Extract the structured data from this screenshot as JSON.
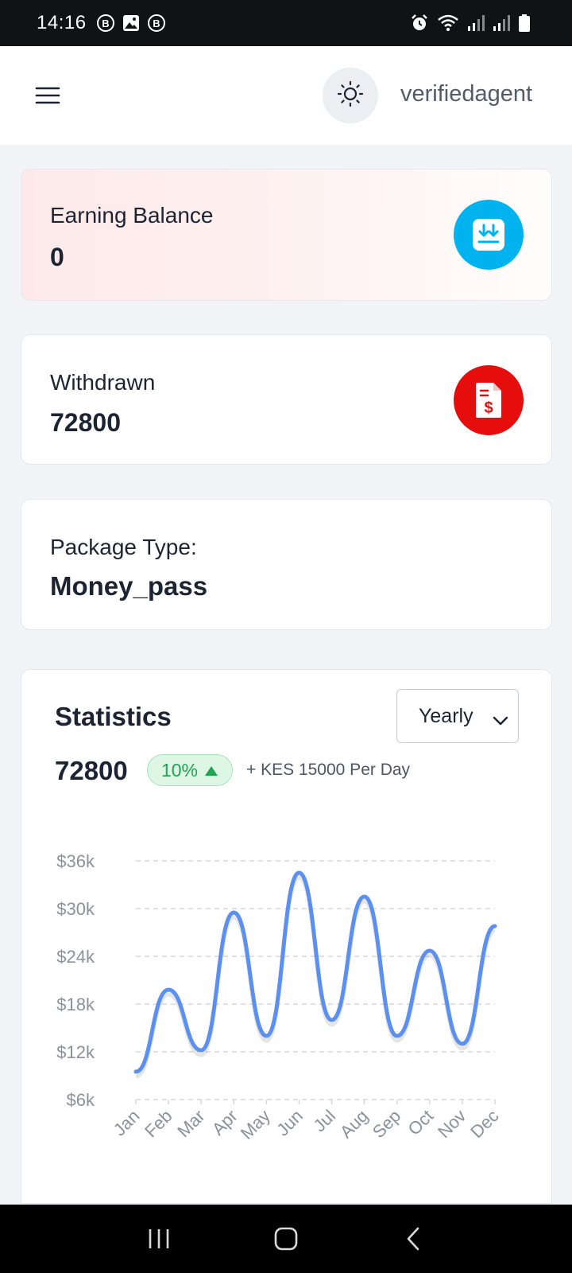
{
  "status_bar": {
    "time": "14:16",
    "left_icons": [
      "b-badge-icon",
      "gallery-icon",
      "b-badge-icon"
    ],
    "right_icons": [
      "alarm-icon",
      "wifi-icon",
      "signal-icon",
      "signal-icon",
      "battery-icon"
    ]
  },
  "header": {
    "username": "verifiedagent"
  },
  "cards": {
    "balance": {
      "label": "Earning Balance",
      "value": "0",
      "icon": "download-icon",
      "icon_color": "#00b3ee"
    },
    "withdrawn": {
      "label": "Withdrawn",
      "value": "72800",
      "icon": "invoice-dollar-icon",
      "icon_color": "#e60d0d"
    },
    "package": {
      "label": "Package Type:",
      "value": "Money_pass"
    }
  },
  "statistics": {
    "title": "Statistics",
    "period": "Yearly",
    "total": "72800",
    "change": "10%",
    "per_day": "+ KES 15000 Per Day",
    "accent": "#22a253"
  },
  "chart_data": {
    "type": "line",
    "categories": [
      "Jan",
      "Feb",
      "Mar",
      "Apr",
      "May",
      "Jun",
      "Jul",
      "Aug",
      "Sep",
      "Oct",
      "Nov",
      "Dec"
    ],
    "series": [
      {
        "values": [
          9.5,
          19.8,
          12.2,
          29.5,
          14.0,
          34.5,
          16.0,
          31.5,
          14.0,
          24.7,
          13.0,
          27.8
        ]
      }
    ],
    "y_ticks": [
      "$6k",
      "$12k",
      "$18k",
      "$24k",
      "$30k",
      "$36k"
    ],
    "ylim": [
      6,
      36
    ],
    "y_unit": "k",
    "grid": true,
    "line_color": "#5b8ff0"
  },
  "nav": {
    "buttons": [
      "recent-apps-icon",
      "home-icon",
      "back-icon"
    ]
  }
}
